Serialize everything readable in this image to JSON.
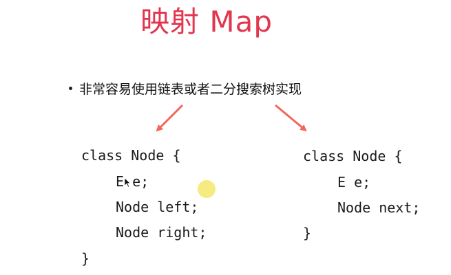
{
  "slide": {
    "title": "映射 Map",
    "bullet": "非常容易使用链表或者二分搜索树实现",
    "accent_color": "#e2354e",
    "arrow_color": "#f0685b"
  },
  "left_code": {
    "line1": "class Node {",
    "line2": "E e;",
    "line3": "Node left;",
    "line4": "Node right;",
    "line5": "}"
  },
  "right_code": {
    "line1": "class Node {",
    "line2": "E e;",
    "line3": "Node next;",
    "line4": "}"
  },
  "icons": {
    "pointer": "mouse-pointer-icon",
    "cursor_highlight": "cursor-highlight"
  }
}
